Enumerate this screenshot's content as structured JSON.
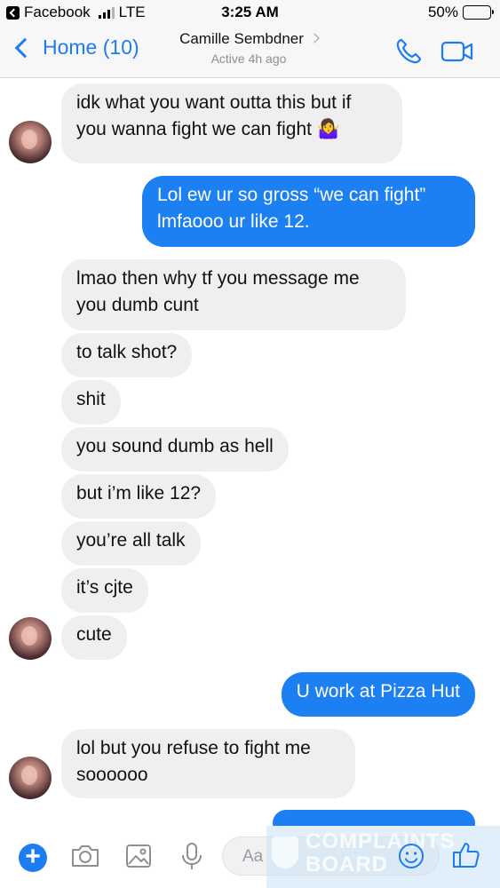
{
  "status_bar": {
    "back_app": "Facebook",
    "network": "LTE",
    "time": "3:25 AM",
    "battery": "50%",
    "battery_level": 0.5
  },
  "header": {
    "back_label": "Home (10)",
    "contact_name": "Camille Sembdner",
    "contact_status": "Active 4h ago",
    "icons": [
      "phone-icon",
      "video-camera-icon"
    ]
  },
  "messages": [
    {
      "from": "them",
      "lines": [
        "idk what you want outta this but if",
        "you wanna fight we can fight 🤷‍♀️"
      ]
    },
    {
      "from": "me",
      "lines": [
        "Lol ew ur so gross “we can fight”",
        "lmfaooo ur like 12."
      ]
    },
    {
      "from": "them",
      "lines": [
        "lmao then why tf you message me",
        "you dumb cunt"
      ]
    },
    {
      "from": "them",
      "lines": [
        "to talk shot?"
      ]
    },
    {
      "from": "them",
      "lines": [
        "shit"
      ]
    },
    {
      "from": "them",
      "lines": [
        "you sound dumb as hell"
      ]
    },
    {
      "from": "them",
      "lines": [
        "but i’m like 12?"
      ]
    },
    {
      "from": "them",
      "lines": [
        "you’re all talk"
      ]
    },
    {
      "from": "them",
      "lines": [
        "it’s cjte"
      ]
    },
    {
      "from": "them",
      "lines": [
        "cute"
      ]
    },
    {
      "from": "me",
      "lines": [
        "U work at Pizza Hut"
      ]
    },
    {
      "from": "them",
      "lines": [
        "lol but you refuse to fight me",
        "soooooo"
      ]
    }
  ],
  "composer": {
    "placeholder": "Aa",
    "icons": [
      "plus-icon",
      "camera-icon",
      "photo-icon",
      "microphone-icon",
      "emoji-icon",
      "thumbs-up-icon"
    ]
  },
  "watermark": {
    "line1": "COMPLAINTS",
    "line2": "BOARD"
  },
  "colors": {
    "accent": "#1d7cf2",
    "outgoing_bubble": "#1c7ff2",
    "incoming_bubble": "#efeff1"
  }
}
